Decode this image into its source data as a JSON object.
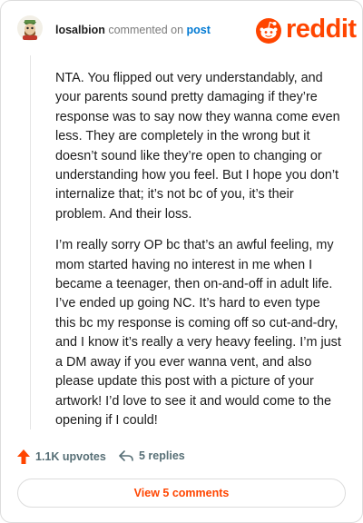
{
  "header": {
    "username": "losalbion",
    "action": "commented on",
    "target": "post",
    "logo_text": "reddit"
  },
  "comment": {
    "paragraphs": [
      "NTA. You flipped out very understandably, and your parents sound pretty damaging if they’re response was to say now they wanna come even less. They are completely in the wrong but it doesn’t sound like they’re open to changing or understanding how you feel. But I hope you don’t internalize that; it’s not bc of you, it’s their problem. And their loss.",
      "I’m really sorry OP bc that’s an awful feeling, my mom started having no interest in me when I became a teenager, then on-and-off in adult life. I’ve ended up going NC. It’s hard to even type this bc my response is coming off so cut-and-dry, and I know it’s really a very heavy feeling. I’m just a DM away if you ever wanna vent, and also please update this post with a picture of your artwork! I’d love to see it and would come to the opening if I could!"
    ]
  },
  "actions": {
    "upvotes": "1.1K upvotes",
    "replies": "5 replies",
    "view_comments": "View 5 comments"
  },
  "colors": {
    "brand": "#ff4500",
    "link": "#0079d3",
    "muted": "#576f76"
  },
  "icons": {
    "upvote": "upvote-arrow-icon",
    "reply": "reply-arrow-icon",
    "logo": "reddit-snoo-icon"
  }
}
